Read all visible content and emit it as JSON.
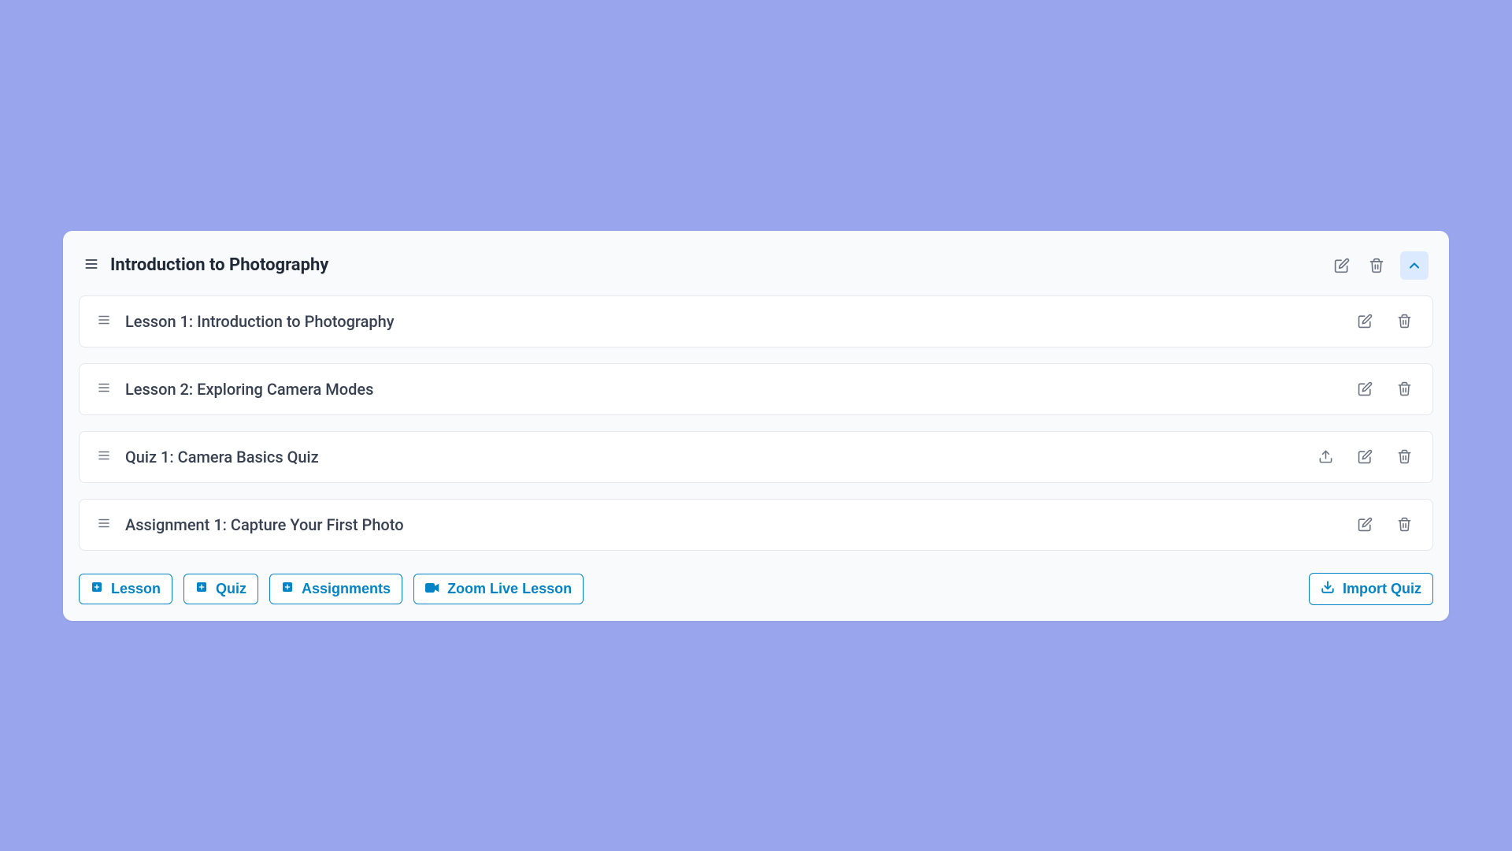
{
  "module": {
    "title": "Introduction to Photography",
    "items": [
      {
        "label": "Lesson 1: Introduction to Photography",
        "type": "lesson"
      },
      {
        "label": "Lesson 2: Exploring Camera Modes",
        "type": "lesson"
      },
      {
        "label": "Quiz 1: Camera Basics Quiz",
        "type": "quiz"
      },
      {
        "label": "Assignment 1: Capture Your First Photo",
        "type": "assignment"
      }
    ]
  },
  "buttons": {
    "lesson": "Lesson",
    "quiz": "Quiz",
    "assignments": "Assignments",
    "zoom": "Zoom Live Lesson",
    "import": "Import Quiz"
  }
}
